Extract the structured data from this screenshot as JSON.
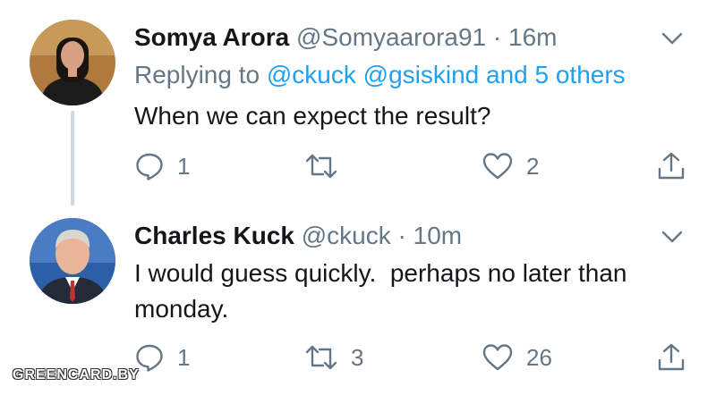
{
  "tweets": [
    {
      "name": "Somya Arora",
      "handle": "@Somyaarora91",
      "separator": "·",
      "time": "16m",
      "reply_prefix": "Replying to",
      "reply_mentions": "@ckuck @gsiskind and 5 others",
      "text": "When we can expect the result?",
      "replies": "1",
      "retweets": "",
      "likes": "2"
    },
    {
      "name": "Charles Kuck",
      "handle": "@ckuck",
      "separator": "·",
      "time": "10m",
      "text": "I would guess quickly.  perhaps no later than monday.",
      "replies": "1",
      "retweets": "3",
      "likes": "26"
    }
  ],
  "icons": {
    "reply": "speech-bubble-icon",
    "retweet": "retweet-icon",
    "like": "heart-icon",
    "share": "share-icon",
    "menu": "chevron-down-icon"
  },
  "colors": {
    "text": "#14171a",
    "secondary": "#657786",
    "link": "#1da1f2",
    "thread_line": "#cfd9de"
  },
  "watermark": "GREENCARD.BY"
}
